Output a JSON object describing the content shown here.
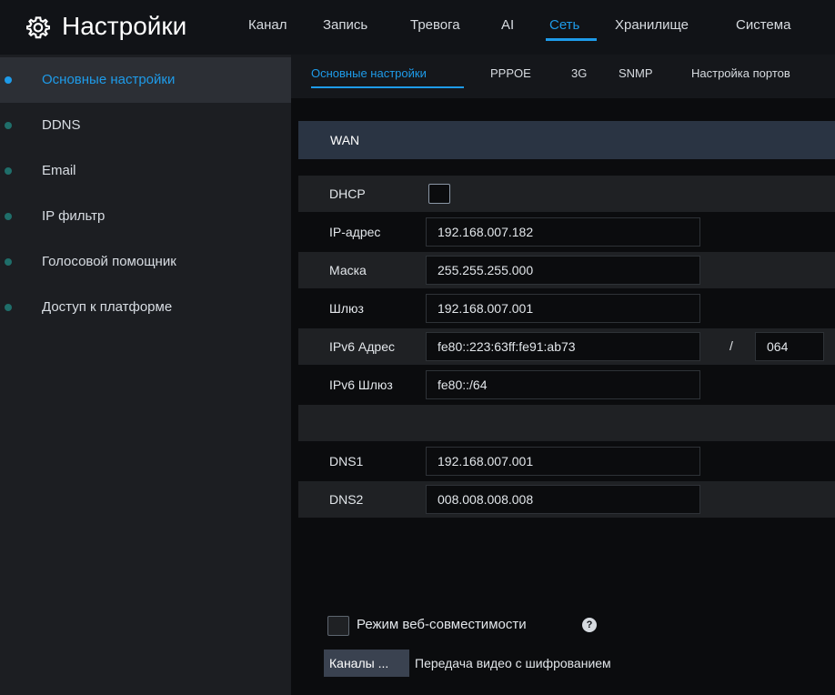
{
  "header": {
    "title": "Настройки",
    "settings_icon": "gear-icon",
    "tabs": [
      {
        "label": "Канал",
        "active": false
      },
      {
        "label": "Запись",
        "active": false
      },
      {
        "label": "Тревога",
        "active": false
      },
      {
        "label": "AI",
        "active": false
      },
      {
        "label": "Сеть",
        "active": true
      },
      {
        "label": "Хранилище",
        "active": false
      },
      {
        "label": "Система",
        "active": false
      }
    ]
  },
  "sidebar": {
    "items": [
      {
        "label": "Основные настройки",
        "active": true,
        "icon": "bullet-dot-icon"
      },
      {
        "label": "DDNS",
        "active": false,
        "icon": "bullet-dot-icon"
      },
      {
        "label": "Email",
        "active": false,
        "icon": "bullet-dot-icon"
      },
      {
        "label": "IP фильтр",
        "active": false,
        "icon": "bullet-dot-icon"
      },
      {
        "label": "Голосовой помощник",
        "active": false,
        "icon": "bullet-dot-icon"
      },
      {
        "label": "Доступ к платформе",
        "active": false,
        "icon": "bullet-dot-icon"
      }
    ]
  },
  "subtabs": [
    {
      "label": "Основные настройки",
      "active": true
    },
    {
      "label": "PPPOE",
      "active": false
    },
    {
      "label": "3G",
      "active": false
    },
    {
      "label": "SNMP",
      "active": false
    },
    {
      "label": "Настройка портов",
      "active": false
    }
  ],
  "wan": {
    "section_label": "WAN",
    "dhcp_label": "DHCP",
    "dhcp_checked": false,
    "ip_label": "IP-адрес",
    "ip_value": "192.168.007.182",
    "mask_label": "Маска",
    "mask_value": "255.255.255.000",
    "gateway_label": "Шлюз",
    "gateway_value": "192.168.007.001",
    "ipv6_label": "IPv6 Адрес",
    "ipv6_value": "fe80::223:63ff:fe91:ab73",
    "ipv6_separator": "/",
    "ipv6_prefix": "064",
    "ipv6_gw_label": "IPv6 Шлюз",
    "ipv6_gw_value": "fe80::/64",
    "dns1_label": "DNS1",
    "dns1_value": "192.168.007.001",
    "dns2_label": "DNS2",
    "dns2_value": "008.008.008.008"
  },
  "footer": {
    "compat_label": "Режим веб-совместимости",
    "compat_checked": false,
    "help_icon": "help-icon",
    "help_glyph": "?",
    "channels_button": "Каналы ...",
    "encryption_label": "Передача видео с шифрованием"
  },
  "colors": {
    "accent": "#1e9be9",
    "sidebar_bg": "#1c1e22",
    "header_bg": "#111317",
    "section_bg": "#2a3443",
    "inactive_dot": "#1f6e6a"
  }
}
